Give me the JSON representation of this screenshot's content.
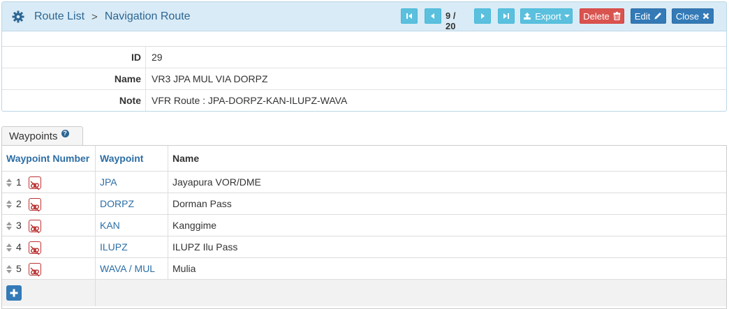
{
  "breadcrumb": {
    "parent": "Route List",
    "separator": ">",
    "current": "Navigation Route"
  },
  "pager": {
    "text": "9 / 20"
  },
  "toolbar": {
    "export_label": "Export",
    "delete_label": "Delete",
    "edit_label": "Edit",
    "close_label": "Close"
  },
  "details": {
    "id_label": "ID",
    "id_value": "29",
    "name_label": "Name",
    "name_value": "VR3 JPA MUL VIA DORPZ",
    "note_label": "Note",
    "note_value": "VFR Route : JPA-DORPZ-KAN-ILUPZ-WAVA"
  },
  "tab": {
    "label": "Waypoints",
    "help": "?"
  },
  "grid": {
    "headers": [
      "Waypoint Number",
      "Waypoint",
      "Name"
    ],
    "rows": [
      {
        "number": "1",
        "waypoint": "JPA",
        "name": "Jayapura VOR/DME"
      },
      {
        "number": "2",
        "waypoint": "DORPZ",
        "name": "Dorman Pass"
      },
      {
        "number": "3",
        "waypoint": "KAN",
        "name": "Kanggime"
      },
      {
        "number": "4",
        "waypoint": "ILUPZ",
        "name": "ILUPZ Ilu Pass"
      },
      {
        "number": "5",
        "waypoint": "WAVA / MUL",
        "name": "Mulia"
      }
    ]
  },
  "colors": {
    "header_bg": "#d9ebf6",
    "link": "#2c6ea5",
    "info_button": "#5bc0de",
    "danger_button": "#d9534f",
    "primary_button": "#337ab7"
  }
}
